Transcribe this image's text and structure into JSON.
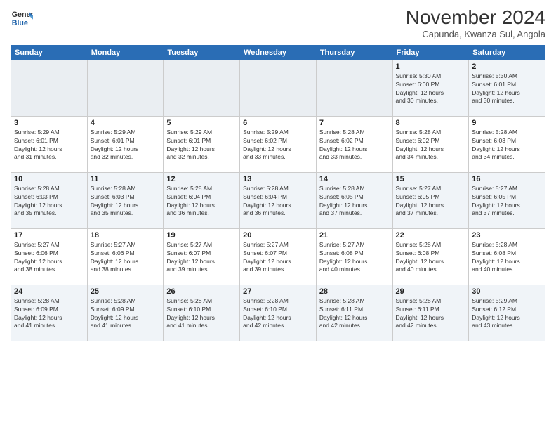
{
  "app": {
    "logo_line1": "General",
    "logo_line2": "Blue"
  },
  "header": {
    "title": "November 2024",
    "subtitle": "Capunda, Kwanza Sul, Angola"
  },
  "weekdays": [
    "Sunday",
    "Monday",
    "Tuesday",
    "Wednesday",
    "Thursday",
    "Friday",
    "Saturday"
  ],
  "weeks": [
    [
      {
        "day": "",
        "info": ""
      },
      {
        "day": "",
        "info": ""
      },
      {
        "day": "",
        "info": ""
      },
      {
        "day": "",
        "info": ""
      },
      {
        "day": "",
        "info": ""
      },
      {
        "day": "1",
        "info": "Sunrise: 5:30 AM\nSunset: 6:00 PM\nDaylight: 12 hours\nand 30 minutes."
      },
      {
        "day": "2",
        "info": "Sunrise: 5:30 AM\nSunset: 6:01 PM\nDaylight: 12 hours\nand 30 minutes."
      }
    ],
    [
      {
        "day": "3",
        "info": "Sunrise: 5:29 AM\nSunset: 6:01 PM\nDaylight: 12 hours\nand 31 minutes."
      },
      {
        "day": "4",
        "info": "Sunrise: 5:29 AM\nSunset: 6:01 PM\nDaylight: 12 hours\nand 32 minutes."
      },
      {
        "day": "5",
        "info": "Sunrise: 5:29 AM\nSunset: 6:01 PM\nDaylight: 12 hours\nand 32 minutes."
      },
      {
        "day": "6",
        "info": "Sunrise: 5:29 AM\nSunset: 6:02 PM\nDaylight: 12 hours\nand 33 minutes."
      },
      {
        "day": "7",
        "info": "Sunrise: 5:28 AM\nSunset: 6:02 PM\nDaylight: 12 hours\nand 33 minutes."
      },
      {
        "day": "8",
        "info": "Sunrise: 5:28 AM\nSunset: 6:02 PM\nDaylight: 12 hours\nand 34 minutes."
      },
      {
        "day": "9",
        "info": "Sunrise: 5:28 AM\nSunset: 6:03 PM\nDaylight: 12 hours\nand 34 minutes."
      }
    ],
    [
      {
        "day": "10",
        "info": "Sunrise: 5:28 AM\nSunset: 6:03 PM\nDaylight: 12 hours\nand 35 minutes."
      },
      {
        "day": "11",
        "info": "Sunrise: 5:28 AM\nSunset: 6:03 PM\nDaylight: 12 hours\nand 35 minutes."
      },
      {
        "day": "12",
        "info": "Sunrise: 5:28 AM\nSunset: 6:04 PM\nDaylight: 12 hours\nand 36 minutes."
      },
      {
        "day": "13",
        "info": "Sunrise: 5:28 AM\nSunset: 6:04 PM\nDaylight: 12 hours\nand 36 minutes."
      },
      {
        "day": "14",
        "info": "Sunrise: 5:28 AM\nSunset: 6:05 PM\nDaylight: 12 hours\nand 37 minutes."
      },
      {
        "day": "15",
        "info": "Sunrise: 5:27 AM\nSunset: 6:05 PM\nDaylight: 12 hours\nand 37 minutes."
      },
      {
        "day": "16",
        "info": "Sunrise: 5:27 AM\nSunset: 6:05 PM\nDaylight: 12 hours\nand 37 minutes."
      }
    ],
    [
      {
        "day": "17",
        "info": "Sunrise: 5:27 AM\nSunset: 6:06 PM\nDaylight: 12 hours\nand 38 minutes."
      },
      {
        "day": "18",
        "info": "Sunrise: 5:27 AM\nSunset: 6:06 PM\nDaylight: 12 hours\nand 38 minutes."
      },
      {
        "day": "19",
        "info": "Sunrise: 5:27 AM\nSunset: 6:07 PM\nDaylight: 12 hours\nand 39 minutes."
      },
      {
        "day": "20",
        "info": "Sunrise: 5:27 AM\nSunset: 6:07 PM\nDaylight: 12 hours\nand 39 minutes."
      },
      {
        "day": "21",
        "info": "Sunrise: 5:27 AM\nSunset: 6:08 PM\nDaylight: 12 hours\nand 40 minutes."
      },
      {
        "day": "22",
        "info": "Sunrise: 5:28 AM\nSunset: 6:08 PM\nDaylight: 12 hours\nand 40 minutes."
      },
      {
        "day": "23",
        "info": "Sunrise: 5:28 AM\nSunset: 6:08 PM\nDaylight: 12 hours\nand 40 minutes."
      }
    ],
    [
      {
        "day": "24",
        "info": "Sunrise: 5:28 AM\nSunset: 6:09 PM\nDaylight: 12 hours\nand 41 minutes."
      },
      {
        "day": "25",
        "info": "Sunrise: 5:28 AM\nSunset: 6:09 PM\nDaylight: 12 hours\nand 41 minutes."
      },
      {
        "day": "26",
        "info": "Sunrise: 5:28 AM\nSunset: 6:10 PM\nDaylight: 12 hours\nand 41 minutes."
      },
      {
        "day": "27",
        "info": "Sunrise: 5:28 AM\nSunset: 6:10 PM\nDaylight: 12 hours\nand 42 minutes."
      },
      {
        "day": "28",
        "info": "Sunrise: 5:28 AM\nSunset: 6:11 PM\nDaylight: 12 hours\nand 42 minutes."
      },
      {
        "day": "29",
        "info": "Sunrise: 5:28 AM\nSunset: 6:11 PM\nDaylight: 12 hours\nand 42 minutes."
      },
      {
        "day": "30",
        "info": "Sunrise: 5:29 AM\nSunset: 6:12 PM\nDaylight: 12 hours\nand 43 minutes."
      }
    ]
  ]
}
